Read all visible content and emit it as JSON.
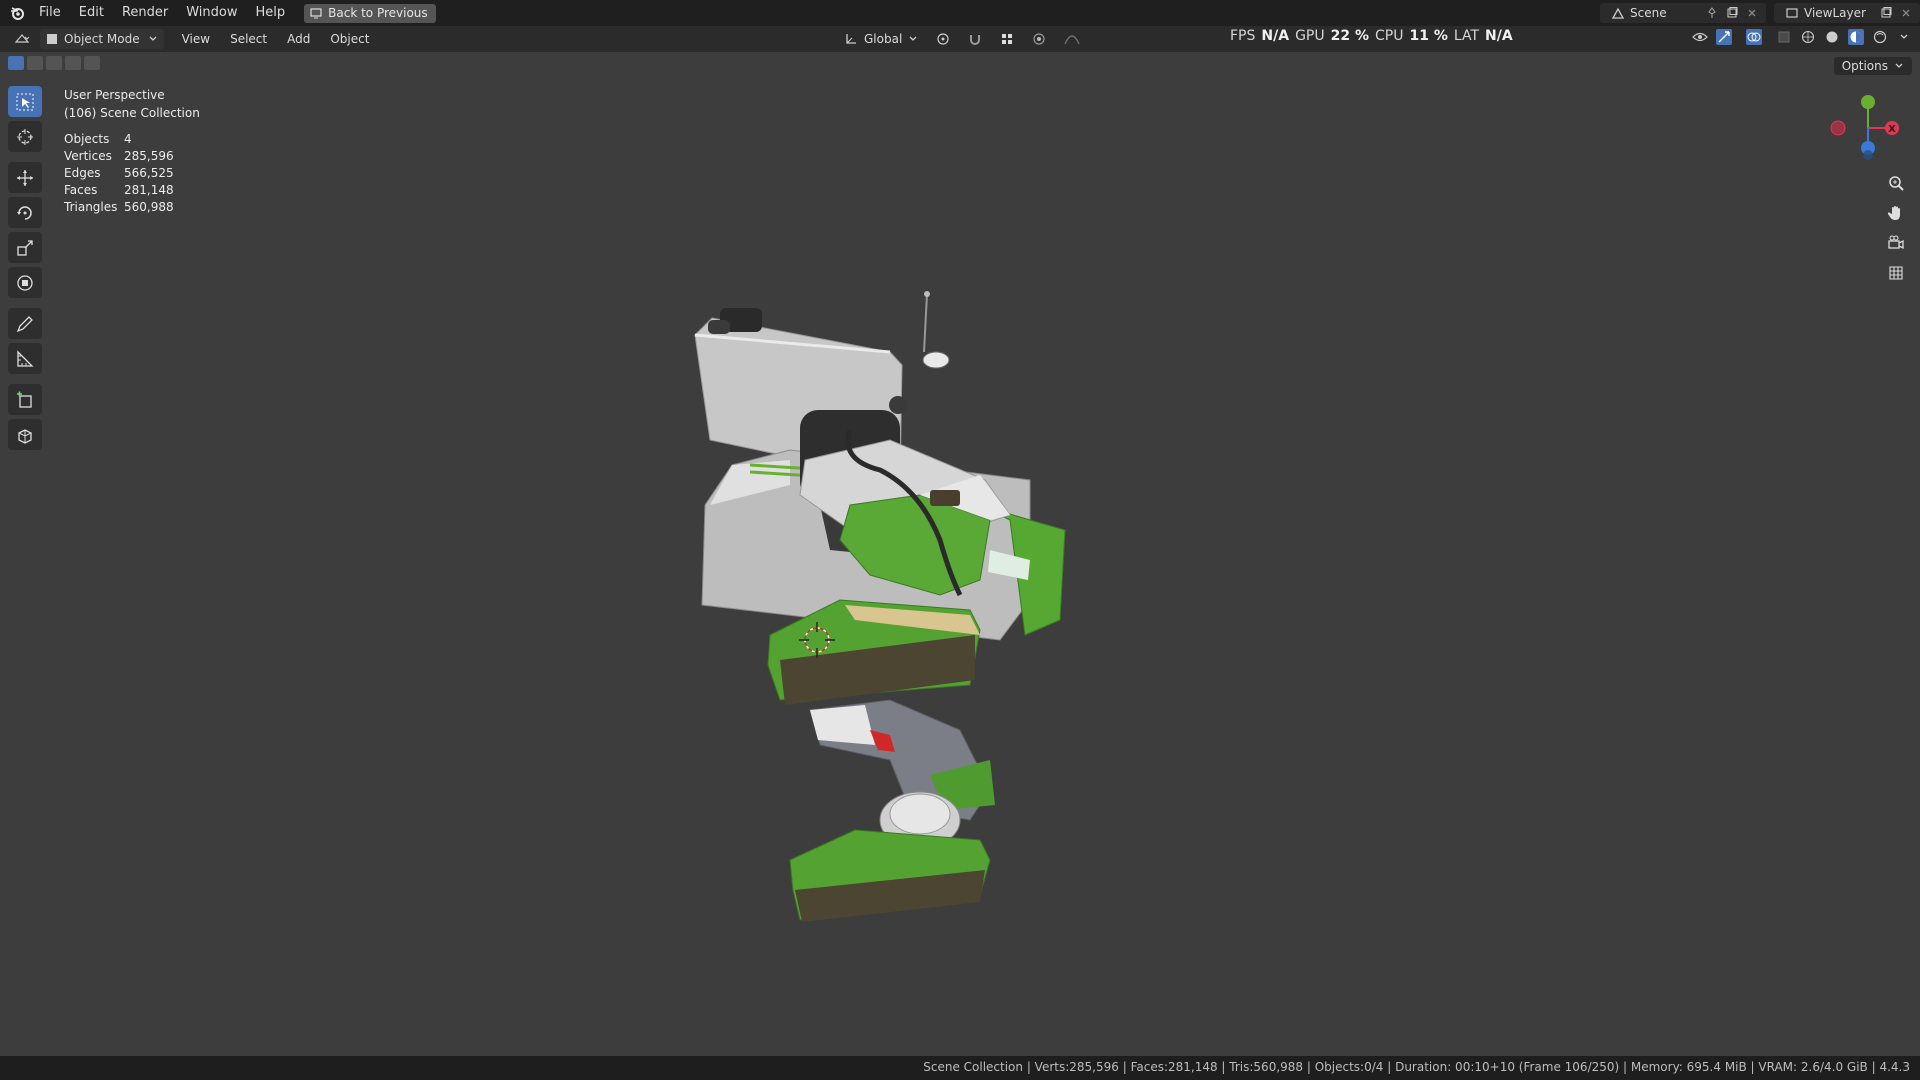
{
  "topbar": {
    "menus": [
      "File",
      "Edit",
      "Render",
      "Window",
      "Help"
    ],
    "back_button": "Back to Previous",
    "scene_label": "Scene",
    "view_layer_label": "ViewLayer"
  },
  "header": {
    "mode": "Object Mode",
    "menus": [
      "View",
      "Select",
      "Add",
      "Object"
    ],
    "transform_orientation": "Global",
    "perf": {
      "fps_label": "FPS",
      "fps_value": "N/A",
      "gpu_label": "GPU",
      "gpu_value": "22 %",
      "cpu_label": "CPU",
      "cpu_value": "11 %",
      "lat_label": "LAT",
      "lat_value": "N/A"
    },
    "options_label": "Options"
  },
  "viewport": {
    "view_name": "User Perspective",
    "collection": "(106) Scene Collection",
    "stats": [
      {
        "key": "Objects",
        "value": "4"
      },
      {
        "key": "Vertices",
        "value": "285,596"
      },
      {
        "key": "Edges",
        "value": "566,525"
      },
      {
        "key": "Faces",
        "value": "281,148"
      },
      {
        "key": "Triangles",
        "value": "560,988"
      }
    ],
    "gizmo_axis_x": "X",
    "colors": {
      "x_axis": "#e0394f",
      "y_axis": "#6ab030",
      "z_axis": "#3a7ad6",
      "accent": "#4772b3"
    }
  },
  "statusbar": {
    "text": "Scene Collection | Verts:285,596 | Faces:281,148 | Tris:560,988 | Objects:0/4 | Duration: 00:10+10 (Frame 106/250) | Memory: 695.4 MiB | VRAM: 2.6/4.0 GiB | 4.4.3"
  }
}
